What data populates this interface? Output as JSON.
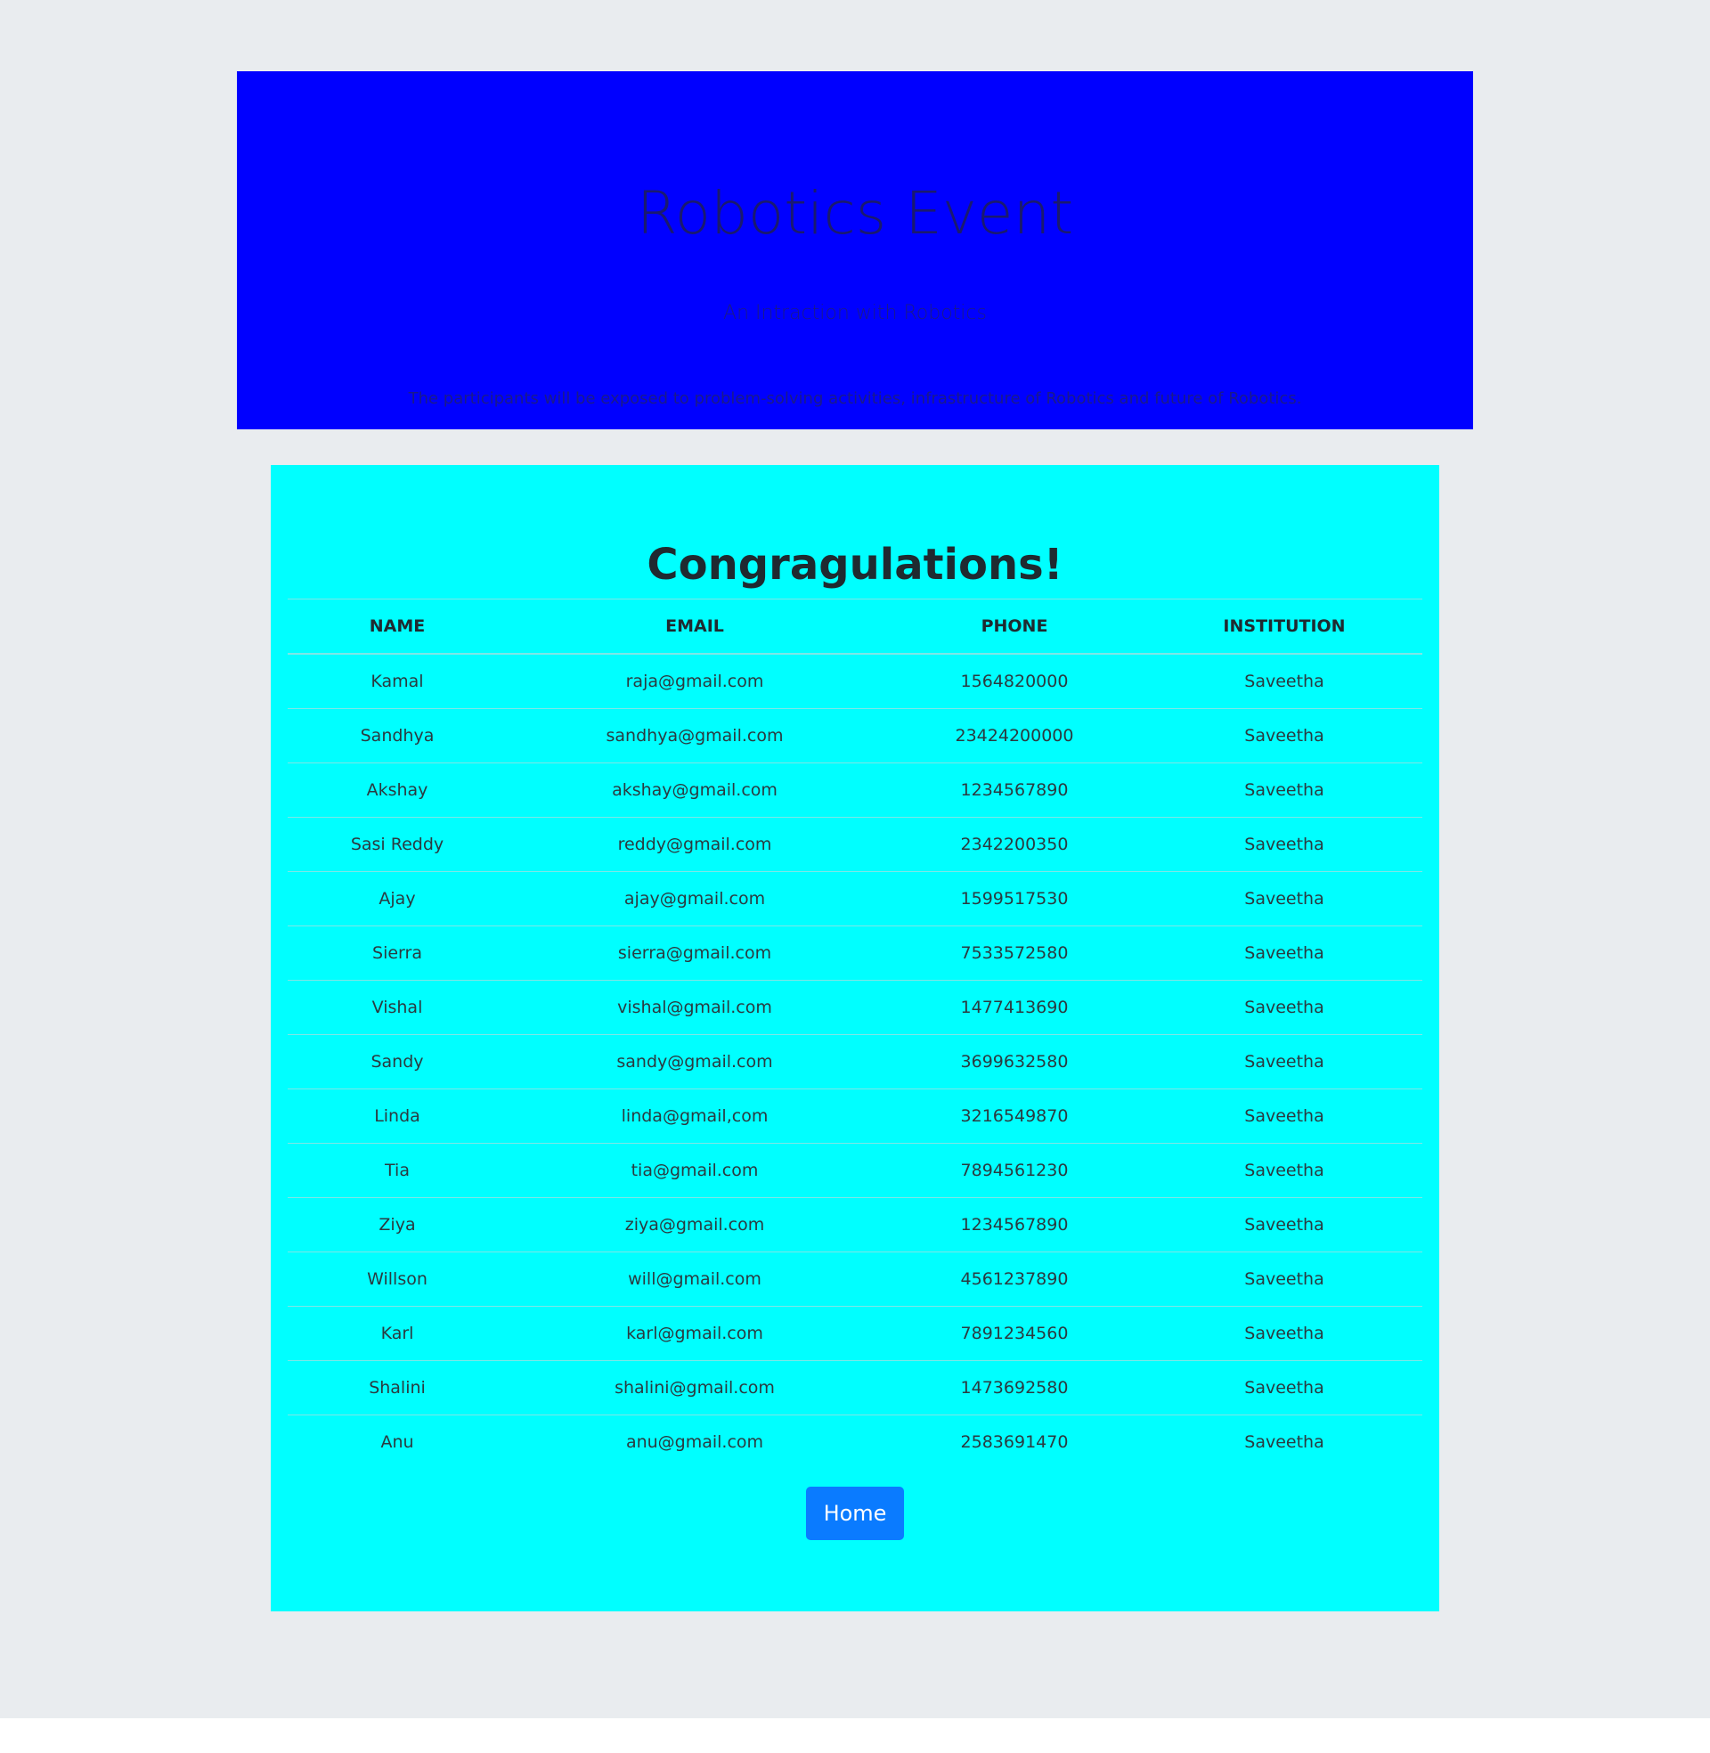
{
  "hero": {
    "title": "Robotics Event",
    "subtitle": "An Intraction with Robotics",
    "description": "The participants will be exposed to problem-solving activities, infrastructure of Robotics and future of Robotics."
  },
  "results": {
    "title": "Congragulations!",
    "columns": [
      "NAME",
      "EMAIL",
      "PHONE",
      "INSTITUTION"
    ],
    "rows": [
      [
        "Kamal",
        "raja@gmail.com",
        "1564820000",
        "Saveetha"
      ],
      [
        "Sandhya",
        "sandhya@gmail.com",
        "23424200000",
        "Saveetha"
      ],
      [
        "Akshay",
        "akshay@gmail.com",
        "1234567890",
        "Saveetha"
      ],
      [
        "Sasi Reddy",
        "reddy@gmail.com",
        "2342200350",
        "Saveetha"
      ],
      [
        "Ajay",
        "ajay@gmail.com",
        "1599517530",
        "Saveetha"
      ],
      [
        "Sierra",
        "sierra@gmail.com",
        "7533572580",
        "Saveetha"
      ],
      [
        "Vishal",
        "vishal@gmail.com",
        "1477413690",
        "Saveetha"
      ],
      [
        "Sandy",
        "sandy@gmail.com",
        "3699632580",
        "Saveetha"
      ],
      [
        "Linda",
        "linda@gmail,com",
        "3216549870",
        "Saveetha"
      ],
      [
        "Tia",
        "tia@gmail.com",
        "7894561230",
        "Saveetha"
      ],
      [
        "Ziya",
        "ziya@gmail.com",
        "1234567890",
        "Saveetha"
      ],
      [
        "Willson",
        "will@gmail.com",
        "4561237890",
        "Saveetha"
      ],
      [
        "Karl",
        "karl@gmail.com",
        "7891234560",
        "Saveetha"
      ],
      [
        "Shalini",
        "shalini@gmail.com",
        "1473692580",
        "Saveetha"
      ],
      [
        "Anu",
        "anu@gmail.com",
        "2583691470",
        "Saveetha"
      ]
    ],
    "home_label": "Home"
  },
  "colors": {
    "page_background": "#e9ecef",
    "hero_background": "#0000ff",
    "card_background": "#00ffff",
    "button_background": "#0a7bff"
  }
}
